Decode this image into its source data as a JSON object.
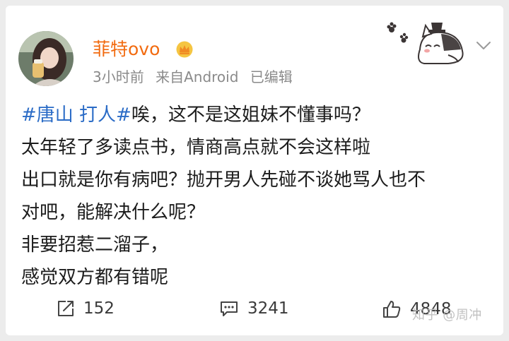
{
  "post": {
    "author": {
      "name": "菲特ovo"
    },
    "meta": {
      "time": "3小时前",
      "source": "来自Android",
      "edited": "已编辑"
    },
    "hashtag": "#唐山 打人#",
    "lines": [
      "唉，这不是这姐妹不懂事吗？",
      "太年轻了多读点书，情商高点就不会这样啦",
      "出口就是你有病吧？抛开男人先碰不谈她骂人也不",
      "对吧，能解决什么呢？",
      "非要招惹二溜子，",
      "感觉双方都有错呢"
    ]
  },
  "actions": {
    "repost": {
      "count": "152",
      "icon": "repost-icon"
    },
    "comment": {
      "count": "3241",
      "icon": "comment-icon"
    },
    "like": {
      "count": "4848",
      "icon": "thumbs-up-icon"
    }
  },
  "watermark": "知乎 @周冲",
  "colors": {
    "username": "#f26b10",
    "hashtag": "#2a6bc6",
    "meta": "#8a8a8a",
    "text": "#1c1c1c"
  }
}
